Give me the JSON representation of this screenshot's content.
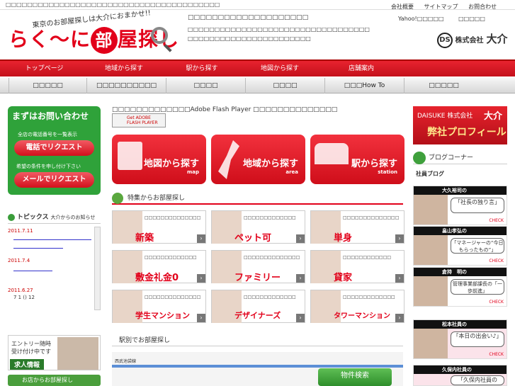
{
  "top_strip": {
    "text": "□□□□□□□□□□□□□□□□□□□□□□□□□□□□□□□□□□□□□□□□"
  },
  "header": {
    "logo_main": "らく〜に",
    "logo_bubble": "部",
    "logo_tail": "屋探し",
    "tagline": "東京のお部屋探しは大介におまかせ!!",
    "line1": "□□□□□□□□□□□□□□□□□□□□",
    "line2": "□□□□□□□□□□□□□□□□□□□□□□□□□□□□□□□□□□",
    "line3": "□□□□□□□□□□□□□□□□□□□□□□□",
    "top_links": [
      "会社概要",
      "サイトマップ",
      "お問合わせ"
    ],
    "search_links": [
      "Yahoo!□□□□□",
      "□□□□□"
    ],
    "corp_name": "株式会社",
    "corp_big": "大介",
    "corp_mark": "DS"
  },
  "nav_primary": [
    "トップページ",
    "地域から探す",
    "駅から探す",
    "地図から探す",
    "店舗案内"
  ],
  "nav_secondary": [
    "□□□□□",
    "□□□□□□□□□□",
    "□□□□",
    "□□□□",
    "□□□How To",
    "□□□□□"
  ],
  "contact": {
    "title": "まずはお問い合わせ",
    "line1": "全店の電話番号を一覧表示",
    "btn1": "電話でリクエスト",
    "line2": "希望の条件を申し付け下さい",
    "btn2": "メールでリクエスト"
  },
  "topics": {
    "title": "トピックス",
    "sub": "大介からのお知らせ",
    "dates": [
      "2011.7.11",
      "2011.7.4",
      "2011.6.27"
    ],
    "last_text": "7 1 ()     12"
  },
  "recruit": {
    "line1": "エントリー随時",
    "line2": "受け付け中です",
    "label": "求人情報"
  },
  "shop_bar": "お店からお部屋探し",
  "flash": {
    "message": "□□□□□□□□□□□□□Adobe Flash Player □□□□□□□□□□□□□□",
    "button": "Get ADOBE FLASH PLAYER"
  },
  "big_buttons": [
    {
      "title": "地図から探す",
      "sub": "map"
    },
    {
      "title": "地域から探す",
      "sub": "area"
    },
    {
      "title": "駅から探す",
      "sub": "station"
    }
  ],
  "feature_title": "特集からお部屋探し",
  "features": [
    {
      "desc": "□□□□□□□□□□□□□□",
      "key": "新築"
    },
    {
      "desc": "□□□□□□□□□□□□□",
      "key": "ペット可"
    },
    {
      "desc": "□□□□□□□□□□□□□□",
      "key": "単身"
    },
    {
      "desc": "□□□□□□□□□□□□□",
      "key": "敷金礼金0"
    },
    {
      "desc": "□□□□□□□□□□□□□□",
      "key": "ファミリー"
    },
    {
      "desc": "□□□□□□□□□□□□",
      "key": "貸家"
    },
    {
      "desc": "□□□□□□□□□□□□□□",
      "key": "学生マンション"
    },
    {
      "desc": "□□□□□□□□□□□□□",
      "key": "デザイナーズ"
    },
    {
      "desc": "□□□□□□□□□□□□□",
      "key": "タワーマンション"
    }
  ],
  "station_title": "駅別でお部屋探し",
  "map_label": "西武池袋線",
  "search_button": "物件検索",
  "profile": {
    "brand": "DAISUKE 株式会社",
    "name": "大介",
    "label": "弊社プロフィール"
  },
  "blog": {
    "title": "ブログコーナー",
    "sub": "社員ブログ",
    "posts": [
      {
        "author": "大久裕司の",
        "quote": "「社長の独り言」"
      },
      {
        "author": "畠山孝弘の",
        "quote": "「マネージャーの“今日もらったもの”」"
      },
      {
        "author": "倉持　明の",
        "quote": "管理事業部課長の「一歩前進」"
      },
      {
        "author": "松本社員の",
        "quote": "「本日の出会い♪」"
      },
      {
        "author": "久保内社員の",
        "quote": "「久保内社員の"
      }
    ],
    "check": "CHECK"
  },
  "colors": {
    "brand_red": "#e2001a",
    "green": "#2fa23a"
  }
}
